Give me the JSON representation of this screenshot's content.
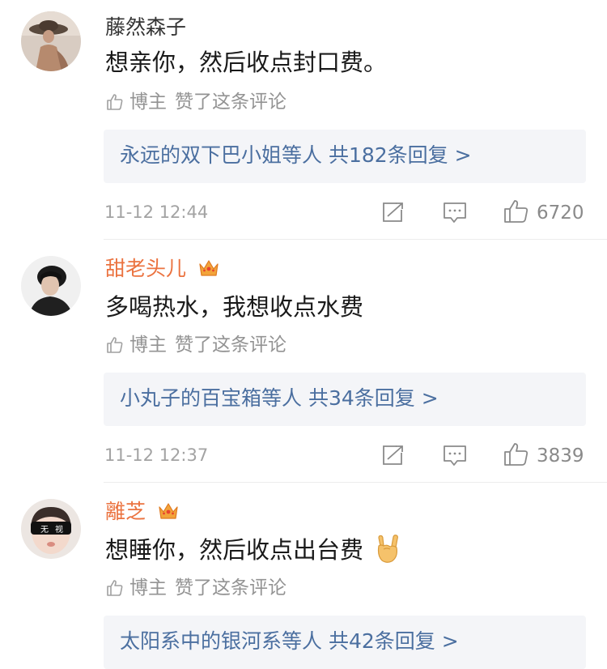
{
  "comments": [
    {
      "username": "藤然森子",
      "vip": false,
      "text": "想亲你，然后收点封口费。",
      "liked_by": {
        "author": "博主",
        "label": "赞了这条评论"
      },
      "replies": "永远的双下巴小姐等人  共182条回复 >",
      "time": "11-12 12:44",
      "likes": "6720"
    },
    {
      "username": "甜老头儿",
      "vip": true,
      "text": "多喝热水，我想收点水费",
      "liked_by": {
        "author": "博主",
        "label": "赞了这条评论"
      },
      "replies": "小丸子的百宝箱等人  共34条回复 >",
      "time": "11-12 12:37",
      "likes": "3839"
    },
    {
      "username": "離芝",
      "vip": true,
      "text": "想睡你，然后收点出台费",
      "emoji": "rock-hand",
      "avatar_sunglasses_text": [
        "无",
        "视"
      ],
      "liked_by": {
        "author": "博主",
        "label": "赞了这条评论"
      },
      "replies": "太阳系中的银河系等人  共42条回复 >"
    }
  ],
  "colors": {
    "vip_name": "#eb7340",
    "link_blue": "#4b6fa0",
    "gray_text": "#939393",
    "reply_bg": "#f4f5f8"
  },
  "icons": [
    "thumb-up-icon",
    "repost-icon",
    "comment-icon",
    "vip-crown-icon",
    "rock-hand-emoji"
  ]
}
